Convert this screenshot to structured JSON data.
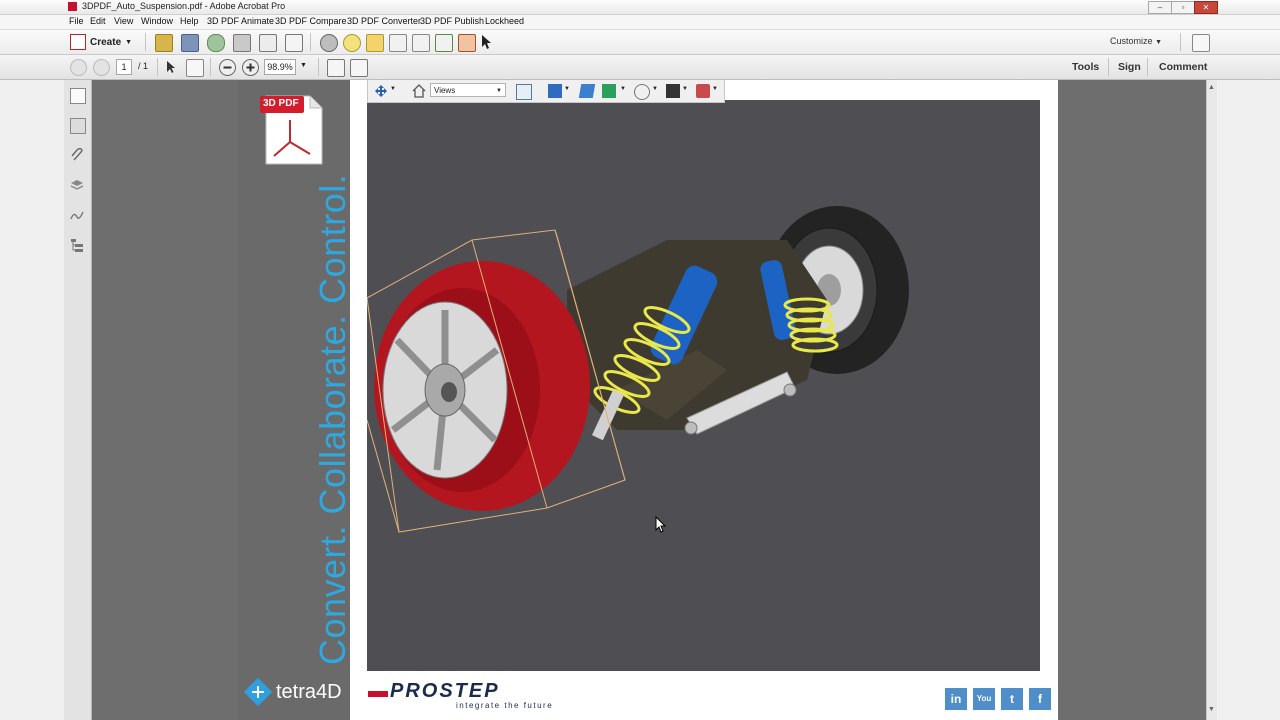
{
  "window": {
    "title": "3DPDF_Auto_Suspension.pdf - Adobe Acrobat Pro"
  },
  "menu": {
    "items": [
      "File",
      "Edit",
      "View",
      "Window",
      "Help",
      "3D PDF Animate",
      "3D PDF Compare",
      "3D PDF Converter",
      "3D PDF Publish",
      "Lockheed"
    ]
  },
  "toolbar": {
    "create_label": "Create",
    "customize_label": "Customize"
  },
  "nav": {
    "page_current": "1",
    "page_total": "/ 1",
    "zoom": "98.9%"
  },
  "right_panels": {
    "tools": "Tools",
    "sign": "Sign",
    "comment": "Comment"
  },
  "toolbar3d": {
    "views_label": "Views"
  },
  "sidebar": {
    "badge_label": "3D PDF",
    "tagline": "Convert. Collaborate. Control.",
    "logo_tetra": "tetra4D"
  },
  "footer": {
    "prostep_name": "PROSTEP",
    "prostep_slogan": "integrate the future"
  },
  "social": [
    {
      "name": "linkedin-icon",
      "label": "in",
      "color": "#4a8bc2"
    },
    {
      "name": "youtube-icon",
      "label": "You",
      "color": "#4a8bc2"
    },
    {
      "name": "twitter-icon",
      "label": "t",
      "color": "#4a8bc2"
    },
    {
      "name": "facebook-icon",
      "label": "f",
      "color": "#4a8bc2"
    }
  ],
  "colors": {
    "tagline": "#2ea8e0",
    "badge": "#d41d2b",
    "viewport_bg": "#4f4e53"
  }
}
